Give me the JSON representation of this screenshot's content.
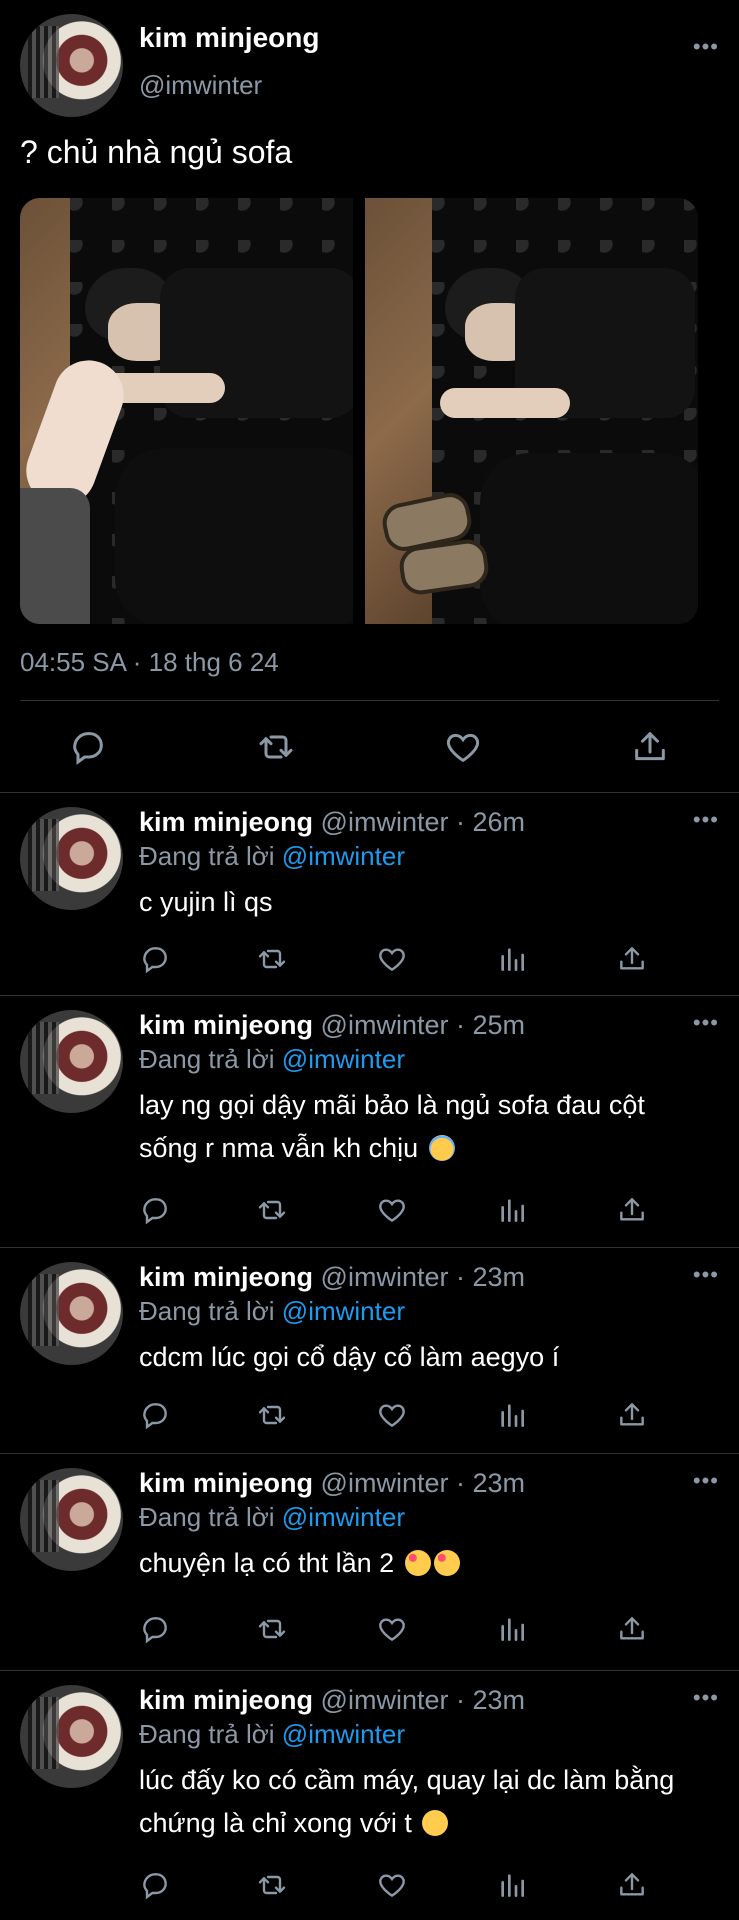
{
  "tweet": {
    "author_name": "kim minjeong",
    "author_handle": "@imwinter",
    "text": "? chủ nhà ngủ sofa",
    "timestamp": "04:55 SA · 18 thg 6 24",
    "more_label": "•••"
  },
  "replies": [
    {
      "name": "kim minjeong",
      "handle": "@imwinter",
      "time": "26m",
      "replying_prefix": "Đang trả lời",
      "mention": "@imwinter",
      "text": "c yujin lì qs",
      "emoji": []
    },
    {
      "name": "kim minjeong",
      "handle": "@imwinter",
      "time": "25m",
      "replying_prefix": "Đang trả lời",
      "mention": "@imwinter",
      "text": "lay ng gọi dậy mãi bảo là ngủ sofa đau cột sống r nma vẫn kh chịu",
      "emoji": [
        "innocent-emoji"
      ]
    },
    {
      "name": "kim minjeong",
      "handle": "@imwinter",
      "time": "23m",
      "replying_prefix": "Đang trả lời",
      "mention": "@imwinter",
      "text": "cdcm lúc gọi cổ dậy cổ làm aegyo í",
      "emoji": []
    },
    {
      "name": "kim minjeong",
      "handle": "@imwinter",
      "time": "23m",
      "replying_prefix": "Đang trả lời",
      "mention": "@imwinter",
      "text": "chuyện lạ có tht lần 2",
      "emoji": [
        "smiling-hearts-emoji",
        "smiling-hearts-emoji"
      ]
    },
    {
      "name": "kim minjeong",
      "handle": "@imwinter",
      "time": "23m",
      "replying_prefix": "Đang trả lời",
      "mention": "@imwinter",
      "text": "lúc đấy ko có cầm máy, quay lại dc làm bằng chứng là chỉ xong với t",
      "emoji": [
        "smiling-emoji"
      ]
    }
  ],
  "icons": {
    "reply": "reply-icon",
    "retweet": "retweet-icon",
    "like": "like-icon",
    "views": "views-icon",
    "share": "share-icon"
  },
  "colors": {
    "background": "#000000",
    "text": "#e7e9ea",
    "secondary": "#8b98a5",
    "mention": "#1d9bf0",
    "divider": "#2f3336"
  }
}
